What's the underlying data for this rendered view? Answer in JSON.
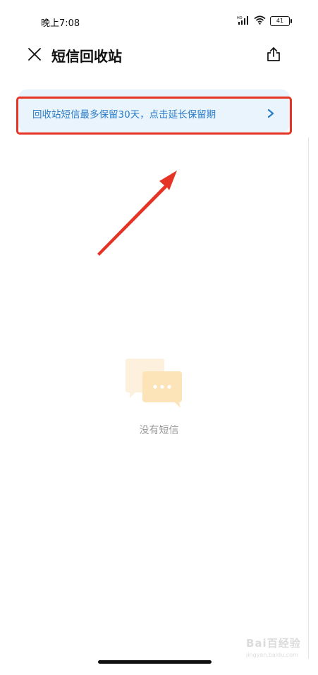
{
  "status_bar": {
    "time": "晚上7:08",
    "signal_label": "HD",
    "battery": "41",
    "icons": [
      "signal-icon",
      "wifi-icon",
      "battery-icon"
    ]
  },
  "header": {
    "title": "短信回收站",
    "close_icon": "close-icon",
    "share_icon": "share-icon"
  },
  "notice": {
    "text": "回收站短信最多保留30天，点击延长保留期",
    "chevron_icon": "chevron-right-icon",
    "text_color": "#2a7cc8",
    "background": "#e9f4fd"
  },
  "annotation": {
    "highlight_color": "#e53326",
    "arrow_color": "#e53326"
  },
  "empty_state": {
    "icon": "chat-bubbles-icon",
    "text": "没有短信"
  },
  "watermark": {
    "logo": "Bai百经验",
    "url": "jingyan.baidu.com"
  }
}
